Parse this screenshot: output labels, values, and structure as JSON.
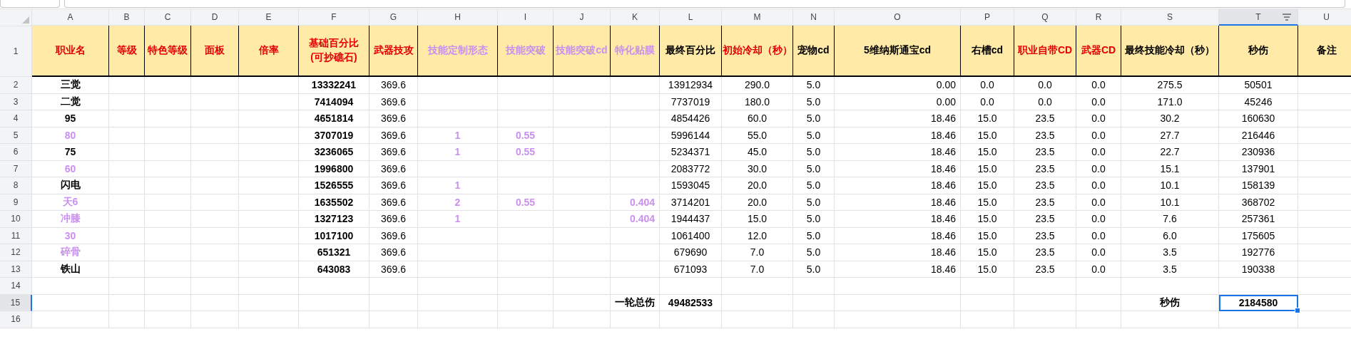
{
  "columns": [
    {
      "letter": "A",
      "selected": false,
      "filter": false
    },
    {
      "letter": "B",
      "selected": false,
      "filter": false
    },
    {
      "letter": "C",
      "selected": false,
      "filter": false
    },
    {
      "letter": "D",
      "selected": false,
      "filter": false
    },
    {
      "letter": "E",
      "selected": false,
      "filter": false
    },
    {
      "letter": "F",
      "selected": false,
      "filter": false
    },
    {
      "letter": "G",
      "selected": false,
      "filter": false
    },
    {
      "letter": "H",
      "selected": false,
      "filter": false
    },
    {
      "letter": "I",
      "selected": false,
      "filter": false
    },
    {
      "letter": "J",
      "selected": false,
      "filter": false
    },
    {
      "letter": "K",
      "selected": false,
      "filter": false
    },
    {
      "letter": "L",
      "selected": false,
      "filter": false
    },
    {
      "letter": "M",
      "selected": false,
      "filter": false
    },
    {
      "letter": "N",
      "selected": false,
      "filter": false
    },
    {
      "letter": "O",
      "selected": false,
      "filter": false
    },
    {
      "letter": "P",
      "selected": false,
      "filter": false
    },
    {
      "letter": "Q",
      "selected": false,
      "filter": false
    },
    {
      "letter": "R",
      "selected": false,
      "filter": false
    },
    {
      "letter": "S",
      "selected": false,
      "filter": false
    },
    {
      "letter": "T",
      "selected": true,
      "filter": true
    },
    {
      "letter": "U",
      "selected": false,
      "filter": false
    }
  ],
  "header_row": {
    "number": "1",
    "selected": false,
    "cells": [
      {
        "text": "职业名",
        "color": "#e60000"
      },
      {
        "text": "等级",
        "color": "#e60000"
      },
      {
        "text": "特色等级",
        "color": "#e60000"
      },
      {
        "text": "面板",
        "color": "#e60000"
      },
      {
        "text": "倍率",
        "color": "#e60000"
      },
      {
        "text": "基础百分比\n(可抄礁石)",
        "color": "#e60000"
      },
      {
        "text": "武器技攻",
        "color": "#e60000"
      },
      {
        "text": "技能定制形态",
        "color": "#c990f0"
      },
      {
        "text": "技能突破",
        "color": "#c990f0"
      },
      {
        "text": "技能突破cd",
        "color": "#c990f0"
      },
      {
        "text": "特化贴膜",
        "color": "#c990f0"
      },
      {
        "text": "最终百分比",
        "color": "#000000"
      },
      {
        "text": "初始冷却（秒）",
        "color": "#e60000"
      },
      {
        "text": "宠物cd",
        "color": "#000000"
      },
      {
        "text": "5维纳斯通宝cd",
        "color": "#000000"
      },
      {
        "text": "右槽cd",
        "color": "#000000"
      },
      {
        "text": "职业自带CD",
        "color": "#e60000"
      },
      {
        "text": "武器CD",
        "color": "#e60000"
      },
      {
        "text": "最终技能冷却（秒）",
        "color": "#000000"
      },
      {
        "text": "秒伤",
        "color": "#000000"
      },
      {
        "text": "备注",
        "color": "#000000"
      }
    ]
  },
  "rows": [
    {
      "number": "2",
      "selected": false,
      "kind": "data",
      "cells": {
        "A": {
          "text": "三觉",
          "color": "#000000"
        },
        "F": "13332241",
        "G": "369.6",
        "L": "13912934",
        "M": "290.0",
        "N": "5.0",
        "O": "0.00",
        "P": "0.0",
        "Q": "0.0",
        "R": "0.0",
        "S": "275.5",
        "T": "50501"
      }
    },
    {
      "number": "3",
      "selected": false,
      "kind": "data",
      "cells": {
        "A": {
          "text": "二觉",
          "color": "#000000"
        },
        "F": "7414094",
        "G": "369.6",
        "L": "7737019",
        "M": "180.0",
        "N": "5.0",
        "O": "0.00",
        "P": "0.0",
        "Q": "0.0",
        "R": "0.0",
        "S": "171.0",
        "T": "45246"
      }
    },
    {
      "number": "4",
      "selected": false,
      "kind": "data",
      "cells": {
        "A": {
          "text": "95",
          "color": "#000000"
        },
        "F": "4651814",
        "G": "369.6",
        "L": "4854426",
        "M": "60.0",
        "N": "5.0",
        "O": "18.46",
        "P": "15.0",
        "Q": "23.5",
        "R": "0.0",
        "S": "30.2",
        "T": "160630"
      }
    },
    {
      "number": "5",
      "selected": false,
      "kind": "data",
      "cells": {
        "A": {
          "text": "80",
          "color": "#c990f0"
        },
        "F": "3707019",
        "G": "369.6",
        "H": "1",
        "I": "0.55",
        "L": "5996144",
        "M": "55.0",
        "N": "5.0",
        "O": "18.46",
        "P": "15.0",
        "Q": "23.5",
        "R": "0.0",
        "S": "27.7",
        "T": "216446"
      }
    },
    {
      "number": "6",
      "selected": false,
      "kind": "data",
      "cells": {
        "A": {
          "text": "75",
          "color": "#000000"
        },
        "F": "3236065",
        "G": "369.6",
        "H": "1",
        "I": "0.55",
        "L": "5234371",
        "M": "45.0",
        "N": "5.0",
        "O": "18.46",
        "P": "15.0",
        "Q": "23.5",
        "R": "0.0",
        "S": "22.7",
        "T": "230936"
      }
    },
    {
      "number": "7",
      "selected": false,
      "kind": "data",
      "cells": {
        "A": {
          "text": "60",
          "color": "#c990f0"
        },
        "F": "1996800",
        "G": "369.6",
        "L": "2083772",
        "M": "30.0",
        "N": "5.0",
        "O": "18.46",
        "P": "15.0",
        "Q": "23.5",
        "R": "0.0",
        "S": "15.1",
        "T": "137901"
      }
    },
    {
      "number": "8",
      "selected": false,
      "kind": "data",
      "cells": {
        "A": {
          "text": "闪电",
          "color": "#000000"
        },
        "F": "1526555",
        "G": "369.6",
        "H": "1",
        "L": "1593045",
        "M": "20.0",
        "N": "5.0",
        "O": "18.46",
        "P": "15.0",
        "Q": "23.5",
        "R": "0.0",
        "S": "10.1",
        "T": "158139"
      }
    },
    {
      "number": "9",
      "selected": false,
      "kind": "data",
      "cells": {
        "A": {
          "text": "天6",
          "color": "#c990f0"
        },
        "F": "1635502",
        "G": "369.6",
        "H": "2",
        "I": "0.55",
        "K": "0.404",
        "L": "3714201",
        "M": "20.0",
        "N": "5.0",
        "O": "18.46",
        "P": "15.0",
        "Q": "23.5",
        "R": "0.0",
        "S": "10.1",
        "T": "368702"
      }
    },
    {
      "number": "10",
      "selected": false,
      "kind": "data",
      "cells": {
        "A": {
          "text": "冲膝",
          "color": "#c990f0"
        },
        "F": "1327123",
        "G": "369.6",
        "H": "1",
        "K": "0.404",
        "L": "1944437",
        "M": "15.0",
        "N": "5.0",
        "O": "18.46",
        "P": "15.0",
        "Q": "23.5",
        "R": "0.0",
        "S": "7.6",
        "T": "257361"
      }
    },
    {
      "number": "11",
      "selected": false,
      "kind": "data",
      "cells": {
        "A": {
          "text": "30",
          "color": "#c990f0"
        },
        "F": "1017100",
        "G": "369.6",
        "L": "1061400",
        "M": "12.0",
        "N": "5.0",
        "O": "18.46",
        "P": "15.0",
        "Q": "23.5",
        "R": "0.0",
        "S": "6.0",
        "T": "175605"
      }
    },
    {
      "number": "12",
      "selected": false,
      "kind": "data",
      "cells": {
        "A": {
          "text": "碎骨",
          "color": "#c990f0"
        },
        "F": "651321",
        "G": "369.6",
        "L": "679690",
        "M": "7.0",
        "N": "5.0",
        "O": "18.46",
        "P": "15.0",
        "Q": "23.5",
        "R": "0.0",
        "S": "3.5",
        "T": "192776"
      }
    },
    {
      "number": "13",
      "selected": false,
      "kind": "data",
      "cells": {
        "A": {
          "text": "铁山",
          "color": "#000000"
        },
        "F": "643083",
        "G": "369.6",
        "L": "671093",
        "M": "7.0",
        "N": "5.0",
        "O": "18.46",
        "P": "15.0",
        "Q": "23.5",
        "R": "0.0",
        "S": "3.5",
        "T": "190338"
      }
    },
    {
      "number": "14",
      "selected": false,
      "kind": "data",
      "cells": {}
    },
    {
      "number": "15",
      "selected": true,
      "kind": "total",
      "cells": {
        "K": "一轮总伤",
        "L": "49482533",
        "S": "秒伤",
        "T": "2184580"
      }
    },
    {
      "number": "16",
      "selected": false,
      "kind": "data",
      "cells": {}
    }
  ]
}
